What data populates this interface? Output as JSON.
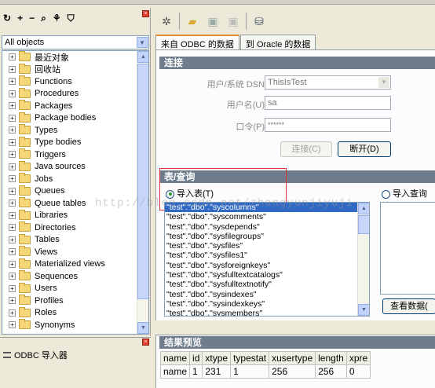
{
  "left_panel": {
    "object_filter": "All objects",
    "tree_items": [
      "最近对象",
      "回收站",
      "Functions",
      "Procedures",
      "Packages",
      "Package bodies",
      "Types",
      "Type bodies",
      "Triggers",
      "Java sources",
      "Jobs",
      "Queues",
      "Queue tables",
      "Libraries",
      "Directories",
      "Tables",
      "Views",
      "Materialized views",
      "Sequences",
      "Users",
      "Profiles",
      "Roles",
      "Synonyms"
    ],
    "bottom_item": "ODBC 导入器"
  },
  "tabs": [
    "来自 ODBC 的数据",
    "到 Oracle 的数据"
  ],
  "connection": {
    "section_title": "连接",
    "dsn_label": "用户/系统 DSN",
    "dsn_value": "ThisIsTest",
    "user_label": "用户名(U)",
    "user_value": "sa",
    "password_label": "口令(P)",
    "password_value": "******",
    "connect_button": "连接(C)",
    "disconnect_button": "断开(D)"
  },
  "query": {
    "section_title": "表/查询",
    "import_table_label": "导入表(T)",
    "import_query_label": "导入查询结",
    "view_data_button": "查看数据(",
    "tables": [
      "\"test\".\"dbo\".\"syscolumns\"",
      "\"test\".\"dbo\".\"syscomments\"",
      "\"test\".\"dbo\".\"sysdepends\"",
      "\"test\".\"dbo\".\"sysfilegroups\"",
      "\"test\".\"dbo\".\"sysfiles\"",
      "\"test\".\"dbo\".\"sysfiles1\"",
      "\"test\".\"dbo\".\"sysforeignkeys\"",
      "\"test\".\"dbo\".\"sysfulltextcatalogs\"",
      "\"test\".\"dbo\".\"sysfulltextnotify\"",
      "\"test\".\"dbo\".\"sysindexes\"",
      "\"test\".\"dbo\".\"sysindexkeys\"",
      "\"test\".\"dbo\".\"sysmembers\""
    ],
    "watermark": "http://blog.csdn.net/zhangyunjiyuji"
  },
  "preview": {
    "section_title": "结果预览",
    "headers": [
      "name",
      "id",
      "xtype",
      "typestat",
      "xusertype",
      "length",
      "xpre"
    ],
    "rows": [
      [
        "name",
        "1",
        "231",
        "1",
        "256",
        "256",
        "0"
      ]
    ]
  }
}
